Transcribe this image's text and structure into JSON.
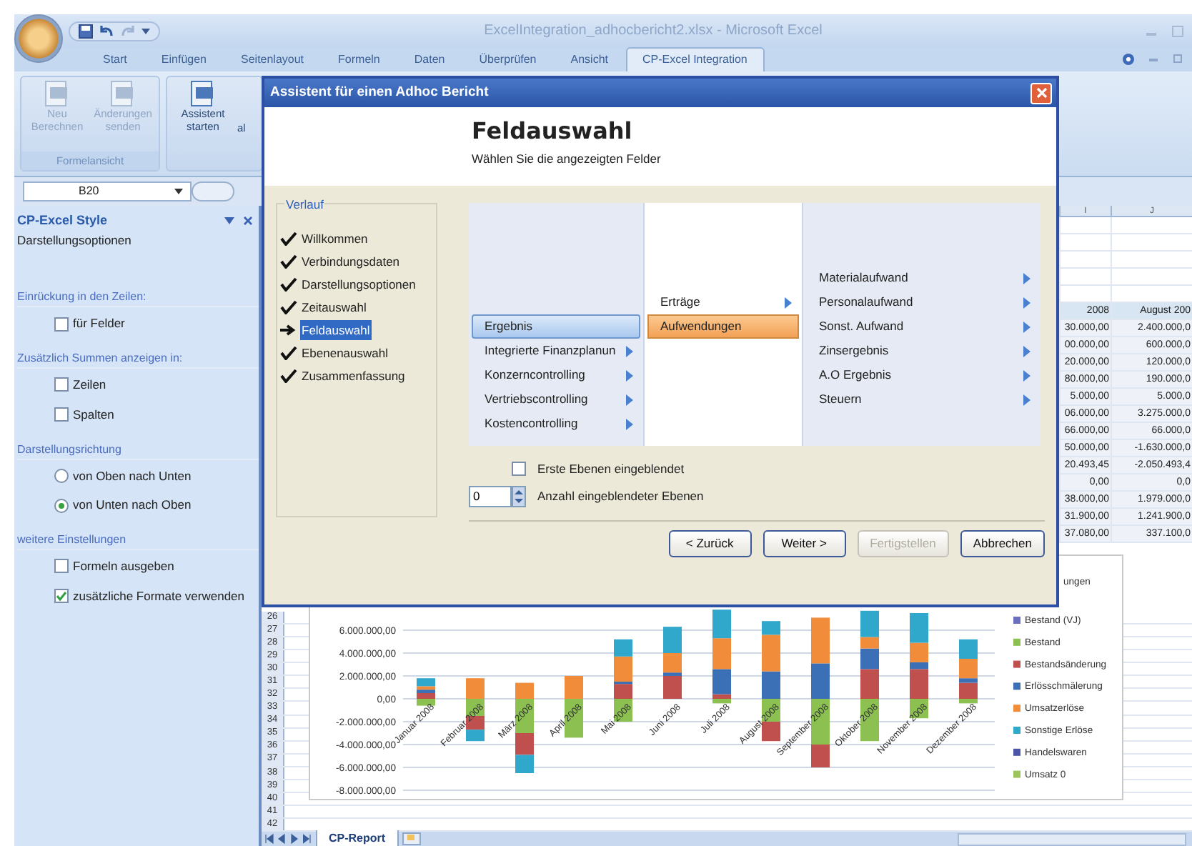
{
  "window": {
    "title": "ExcelIntegration_adhocbericht2.xlsx - Microsoft Excel"
  },
  "ribbon_tabs": [
    {
      "label": "Start",
      "selected": false
    },
    {
      "label": "Einfügen",
      "selected": false
    },
    {
      "label": "Seitenlayout",
      "selected": false
    },
    {
      "label": "Formeln",
      "selected": false
    },
    {
      "label": "Daten",
      "selected": false
    },
    {
      "label": "Überprüfen",
      "selected": false
    },
    {
      "label": "Ansicht",
      "selected": false
    },
    {
      "label": "CP-Excel Integration",
      "selected": true
    }
  ],
  "ribbon_groups": [
    {
      "label": "Formelansicht",
      "buttons": [
        {
          "label": "Neu Berechnen",
          "disabled": true
        },
        {
          "label": "Änderungen senden",
          "disabled": true
        }
      ]
    },
    {
      "buttons": [
        {
          "label": "Assistent starten",
          "disabled": false
        },
        {
          "label": "al",
          "disabled": false
        }
      ]
    }
  ],
  "name_box": {
    "value": "B20"
  },
  "task_pane": {
    "title": "CP-Excel Style",
    "subtitle": "Darstellungsoptionen",
    "sections": [
      {
        "heading": "Einrückung in den Zeilen:",
        "options": [
          {
            "kind": "checkbox",
            "label": "für Felder",
            "checked": false
          }
        ]
      },
      {
        "heading": "Zusätzlich Summen anzeigen in:",
        "options": [
          {
            "kind": "checkbox",
            "label": "Zeilen",
            "checked": false
          },
          {
            "kind": "checkbox",
            "label": "Spalten",
            "checked": false
          }
        ]
      },
      {
        "heading": "Darstellungsrichtung",
        "options": [
          {
            "kind": "radio",
            "label": "von Oben nach Unten",
            "checked": false
          },
          {
            "kind": "radio",
            "label": "von Unten nach Oben",
            "checked": true
          }
        ]
      },
      {
        "heading": "weitere Einstellungen",
        "options": [
          {
            "kind": "checkbox",
            "label": "Formeln ausgeben",
            "checked": false
          },
          {
            "kind": "checkbox",
            "label": "zusätzliche Formate verwenden",
            "checked": true
          }
        ]
      }
    ]
  },
  "sheet": {
    "columns": [
      "I",
      "J"
    ],
    "header_row": [
      "2008",
      "August 200"
    ],
    "rows": [
      [
        "30.000,00",
        "2.400.000,0"
      ],
      [
        "00.000,00",
        "600.000,0"
      ],
      [
        "20.000,00",
        "120.000,0"
      ],
      [
        "80.000,00",
        "190.000,0"
      ],
      [
        "5.000,00",
        "5.000,0"
      ],
      [
        "06.000,00",
        "3.275.000,0"
      ],
      [
        "66.000,00",
        "66.000,0"
      ],
      [
        "50.000,00",
        "-1.630.000,0"
      ],
      [
        "20.493,45",
        "-2.050.493,4"
      ],
      [
        "0,00",
        "0,0"
      ],
      [
        "38.000,00",
        "1.979.000,0"
      ],
      [
        "31.900,00",
        "1.241.900,0"
      ],
      [
        "37.080,00",
        "337.100,0"
      ]
    ],
    "row_numbers": [
      "26",
      "27",
      "28",
      "29",
      "30",
      "31",
      "32",
      "33",
      "34",
      "35",
      "36",
      "37",
      "38",
      "39",
      "40",
      "41",
      "42"
    ],
    "tabs": [
      {
        "label": "CP-Report",
        "selected": true
      }
    ]
  },
  "chart": {
    "legend_fragment": "ungen",
    "chart_data": {
      "type": "bar",
      "stacked": true,
      "grid": true,
      "legend": "right",
      "categories": [
        "Januar 2008",
        "Februar 2008",
        "März 2008",
        "April 2008",
        "Mai 2008",
        "Juni 2008",
        "Juli 2008",
        "August 2008",
        "September 2008",
        "Oktober 2008",
        "November 2008",
        "Dezember 2008"
      ],
      "ylim": [
        -8000000,
        8000000
      ],
      "yticks": [
        {
          "value": 6000000,
          "label": "6.000.000,00"
        },
        {
          "value": 4000000,
          "label": "4.000.000,00"
        },
        {
          "value": 2000000,
          "label": "2.000.000,00"
        },
        {
          "value": 0,
          "label": "0,00"
        },
        {
          "value": -2000000,
          "label": "-2.000.000,00"
        },
        {
          "value": -4000000,
          "label": "-4.000.000,00"
        },
        {
          "value": -6000000,
          "label": "-6.000.000,00"
        },
        {
          "value": -8000000,
          "label": "-8.000.000,00"
        }
      ],
      "series": [
        {
          "name": "Bestand (VJ)",
          "color": "#6a6fc0",
          "values": [
            0,
            0,
            0,
            0,
            0,
            0,
            0,
            0,
            0,
            0,
            0,
            0
          ]
        },
        {
          "name": "Bestand",
          "color": "#8cc152",
          "values": [
            -600000,
            -1500000,
            -3000000,
            -3400000,
            -2000000,
            0,
            -400000,
            -2000000,
            -4000000,
            -3700000,
            -1700000,
            -400000
          ]
        },
        {
          "name": "Bestandsänderung",
          "color": "#c0504d",
          "values": [
            500000,
            -1200000,
            -1900000,
            0,
            1300000,
            2000000,
            400000,
            -1700000,
            -2000000,
            2600000,
            2600000,
            1400000
          ]
        },
        {
          "name": "Erlösschmälerung",
          "color": "#3b6fb6",
          "values": [
            300000,
            0,
            0,
            0,
            200000,
            300000,
            2200000,
            2400000,
            3100000,
            1800000,
            600000,
            400000
          ]
        },
        {
          "name": "Umsatzerlöse",
          "color": "#f08c3a",
          "values": [
            300000,
            1800000,
            1400000,
            2000000,
            2200000,
            1700000,
            2700000,
            3200000,
            4000000,
            1000000,
            1700000,
            1700000
          ]
        },
        {
          "name": "Sonstige Erlöse",
          "color": "#2fa8cc",
          "values": [
            700000,
            -1000000,
            -1600000,
            0,
            1500000,
            2300000,
            2500000,
            1200000,
            0,
            2300000,
            2600000,
            1700000
          ]
        },
        {
          "name": "Handelswaren",
          "color": "#4a55a8",
          "values": [
            0,
            0,
            0,
            0,
            0,
            0,
            0,
            0,
            0,
            0,
            0,
            0
          ]
        },
        {
          "name": "Umsatz 0",
          "color": "#9bc45a",
          "values": [
            0,
            0,
            0,
            0,
            0,
            0,
            0,
            0,
            0,
            0,
            0,
            0
          ]
        }
      ]
    }
  },
  "dialog": {
    "title": "Assistent für einen Adhoc Bericht",
    "heading": "Feldauswahl",
    "subheading": "Wählen Sie die angezeigten Felder",
    "steps_title": "Verlauf",
    "steps": [
      {
        "label": "Willkommen",
        "selected": false
      },
      {
        "label": "Verbindungsdaten",
        "selected": false
      },
      {
        "label": "Darstellungsoptionen",
        "selected": false
      },
      {
        "label": "Zeitauswahl",
        "selected": false
      },
      {
        "label": "Feldauswahl",
        "selected": true
      },
      {
        "label": "Ebenenauswahl",
        "selected": false
      },
      {
        "label": "Zusammenfassung",
        "selected": false
      }
    ],
    "field_columns": [
      [
        {
          "label": "Ergebnis",
          "selected": true,
          "has_children": false
        },
        {
          "label": "Integrierte Finanzplanun",
          "selected": false,
          "has_children": true
        },
        {
          "label": "Konzerncontrolling",
          "selected": false,
          "has_children": true
        },
        {
          "label": "Vertriebscontrolling",
          "selected": false,
          "has_children": true
        },
        {
          "label": "Kostencontrolling",
          "selected": false,
          "has_children": true
        }
      ],
      [
        {
          "label": "Erträge",
          "selected": false,
          "has_children": true
        },
        {
          "label": "Aufwendungen",
          "selected": true,
          "has_children": false
        }
      ],
      [
        {
          "label": "Materialaufwand",
          "selected": false,
          "has_children": true
        },
        {
          "label": "Personalaufwand",
          "selected": false,
          "has_children": true
        },
        {
          "label": "Sonst. Aufwand",
          "selected": false,
          "has_children": true
        },
        {
          "label": "Zinsergebnis",
          "selected": false,
          "has_children": true
        },
        {
          "label": "A.O Ergebnis",
          "selected": false,
          "has_children": true
        },
        {
          "label": "Steuern",
          "selected": false,
          "has_children": true
        }
      ]
    ],
    "first_levels": {
      "label": "Erste Ebenen eingeblendet",
      "checked": false
    },
    "level_count": {
      "value": "0",
      "label": "Anzahl eingeblendeter Ebenen"
    },
    "buttons": [
      {
        "label": "< Zurück",
        "disabled": false
      },
      {
        "label": "Weiter >",
        "disabled": false
      },
      {
        "label": "Fertigstellen",
        "disabled": true
      },
      {
        "label": "Abbrechen",
        "disabled": false
      }
    ]
  }
}
